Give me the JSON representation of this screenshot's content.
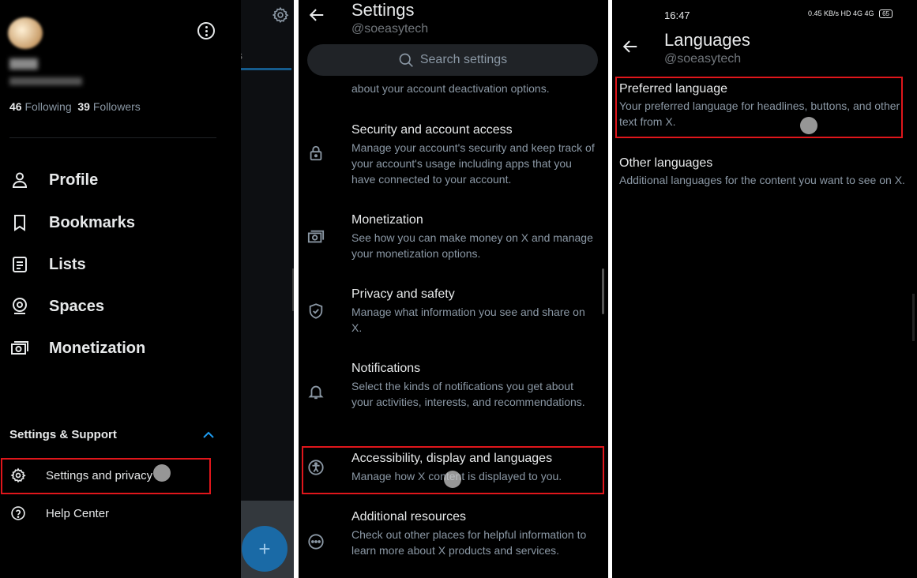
{
  "panel1": {
    "following_count": "46",
    "following_label": "Following",
    "followers_count": "39",
    "followers_label": "Followers",
    "tab_fragment": "s",
    "nav": [
      {
        "label": "Profile",
        "icon": "person-icon"
      },
      {
        "label": "Bookmarks",
        "icon": "bookmark-icon"
      },
      {
        "label": "Lists",
        "icon": "list-icon"
      },
      {
        "label": "Spaces",
        "icon": "spaces-icon"
      },
      {
        "label": "Monetization",
        "icon": "money-icon"
      }
    ],
    "section_title": "Settings & Support",
    "sub": [
      {
        "label": "Settings and privacy",
        "icon": "gear-icon"
      },
      {
        "label": "Help Center",
        "icon": "help-icon"
      }
    ],
    "fab_symbol": "+"
  },
  "panel2": {
    "title": "Settings",
    "handle": "@soeasytech",
    "search_placeholder": "Search settings",
    "cut_text": "about your account deactivation options.",
    "items": [
      {
        "title": "Security and account access",
        "desc": "Manage your account's security and keep track of your account's usage including apps that you have connected to your account.",
        "icon": "lock-icon"
      },
      {
        "title": "Monetization",
        "desc": "See how you can make money on X and manage your monetization options.",
        "icon": "money-icon"
      },
      {
        "title": "Privacy and safety",
        "desc": "Manage what information you see and share on X.",
        "icon": "shield-icon"
      },
      {
        "title": "Notifications",
        "desc": "Select the kinds of notifications you get about your activities, interests, and recommendations.",
        "icon": "bell-icon"
      },
      {
        "title": "Accessibility, display and languages",
        "desc": "Manage how X content is displayed to you.",
        "icon": "accessibility-icon"
      },
      {
        "title": "Additional resources",
        "desc": "Check out other places for helpful information to learn more about X products and services.",
        "icon": "more-circle-icon"
      }
    ]
  },
  "panel3": {
    "time": "16:47",
    "status_right": "0.45 KB/s HD 4G 4G",
    "battery": "65",
    "title": "Languages",
    "handle": "@soeasytech",
    "items": [
      {
        "title": "Preferred language",
        "desc": "Your preferred language for headlines, buttons, and other text from X."
      },
      {
        "title": "Other languages",
        "desc": "Additional languages for the content you want to see on X."
      }
    ]
  },
  "colors": {
    "background": "#000000",
    "text": "#e7e9ea",
    "secondary_text": "#8b98a5",
    "accent": "#1d9bf0",
    "highlight": "#e0161b"
  }
}
